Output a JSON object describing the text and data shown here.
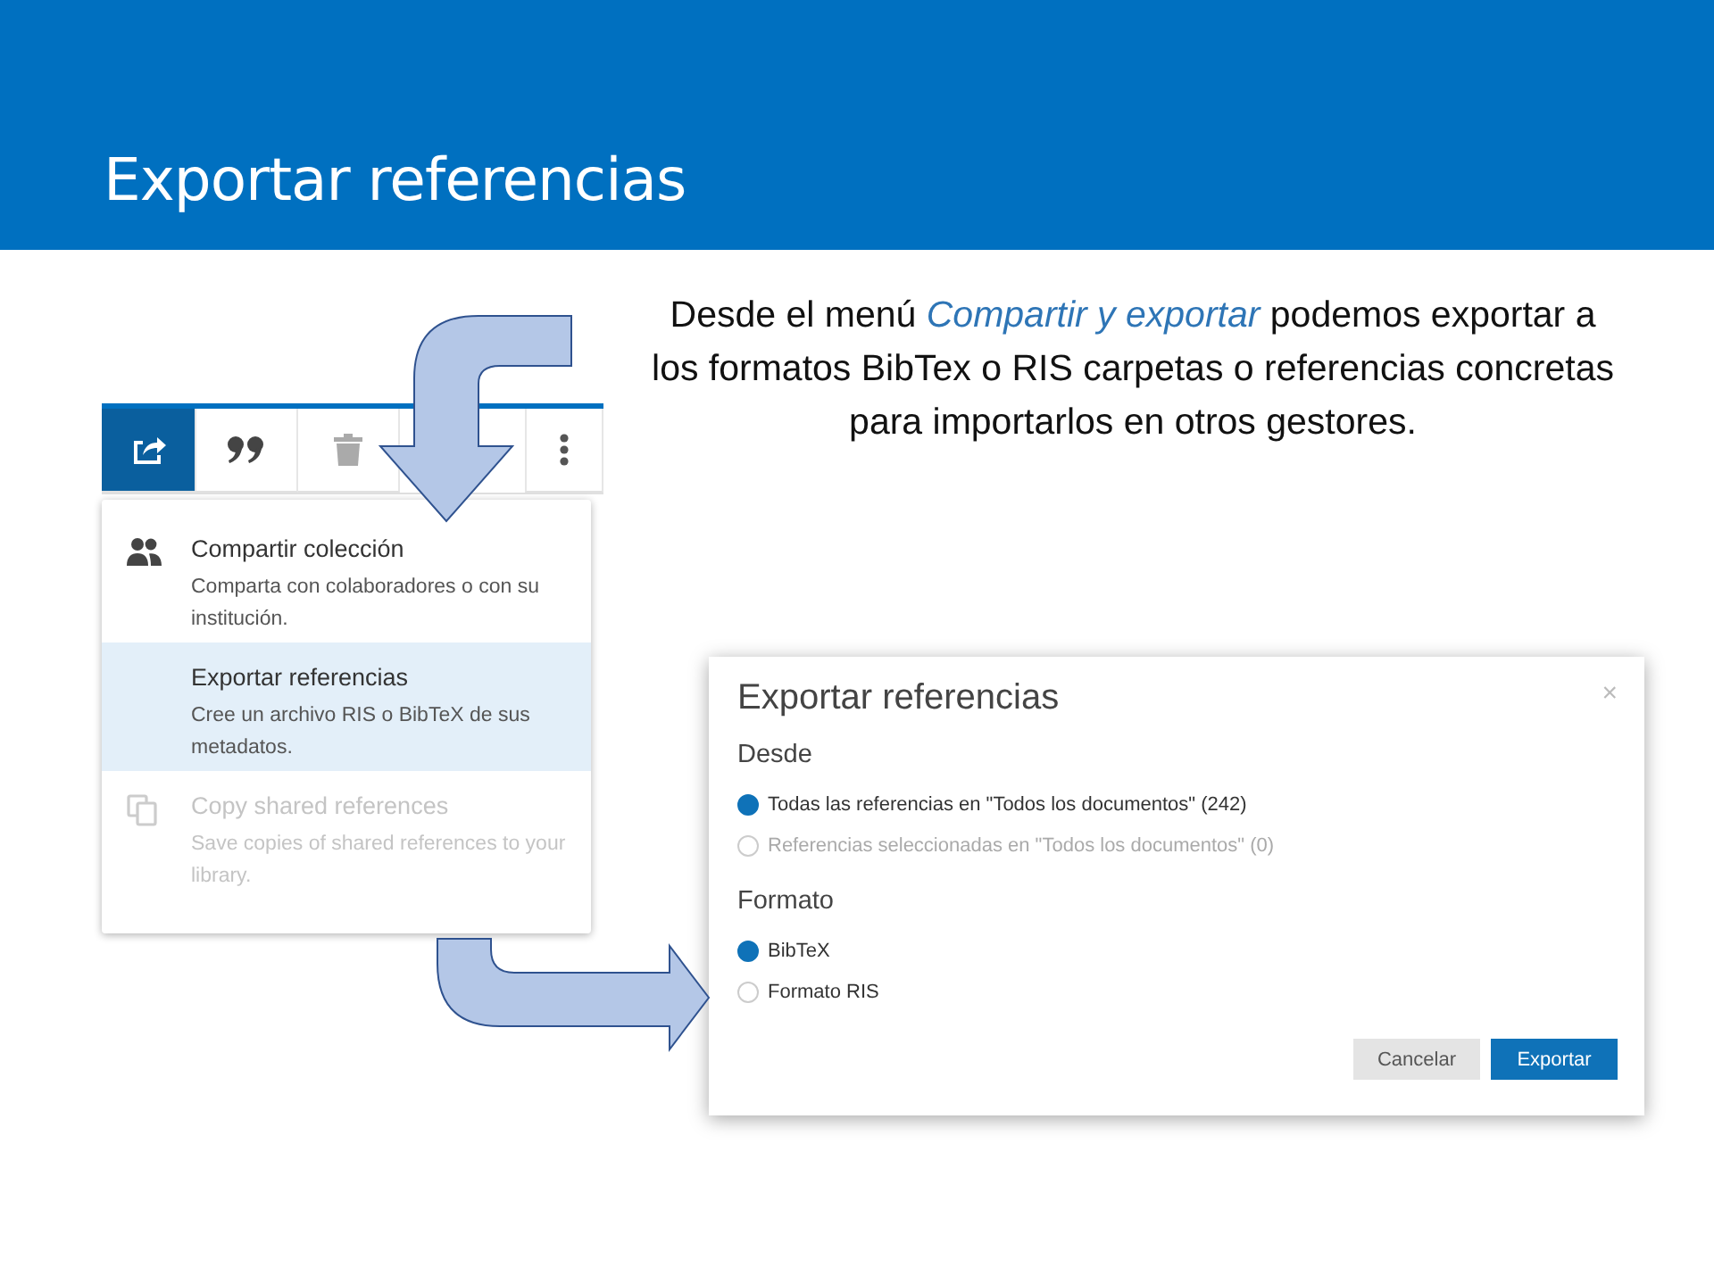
{
  "slide": {
    "title": "Exportar referencias",
    "caption": "Desde el menú *Compartir y exportar* podemos exportar a los formatos BibTex o RIS carpetas o referencias concretas para importarlos en otros gestores."
  },
  "toolbar": {
    "buttons": [
      {
        "kind": "share",
        "selected": true
      },
      {
        "kind": "quote",
        "selected": false
      },
      {
        "kind": "trash",
        "selected": false
      },
      {
        "kind": "more",
        "selected": false
      }
    ]
  },
  "menu": {
    "items": [
      {
        "kind": "people",
        "title": "Compartir colección",
        "description": "Comparta con colaboradores o con su institución.",
        "selected": false,
        "disabled": false
      },
      {
        "kind": "none",
        "title": "Exportar referencias",
        "description": "Cree un archivo RIS o BibTeX de sus metadatos.",
        "selected": true,
        "disabled": false
      },
      {
        "kind": "copy",
        "title": "Copy shared references",
        "description": "Save copies of shared references to your library.",
        "selected": false,
        "disabled": true
      }
    ]
  },
  "dialog": {
    "title": "Exportar referencias",
    "close": "×",
    "sections": [
      {
        "heading": "Desde",
        "options": [
          {
            "label": "Todas las referencias en \"Todos los documentos\" (242)",
            "selected": true,
            "disabled": false
          },
          {
            "label": "Referencias seleccionadas en \"Todos los documentos\" (0)",
            "selected": false,
            "disabled": true
          }
        ]
      },
      {
        "heading": "Formato",
        "options": [
          {
            "label": "BibTeX",
            "selected": true,
            "disabled": false
          },
          {
            "label": "Formato RIS",
            "selected": false,
            "disabled": false
          }
        ]
      }
    ],
    "buttons": [
      {
        "label": "Cancelar",
        "kind": "secondary"
      },
      {
        "label": "Exportar",
        "kind": "primary"
      }
    ]
  }
}
